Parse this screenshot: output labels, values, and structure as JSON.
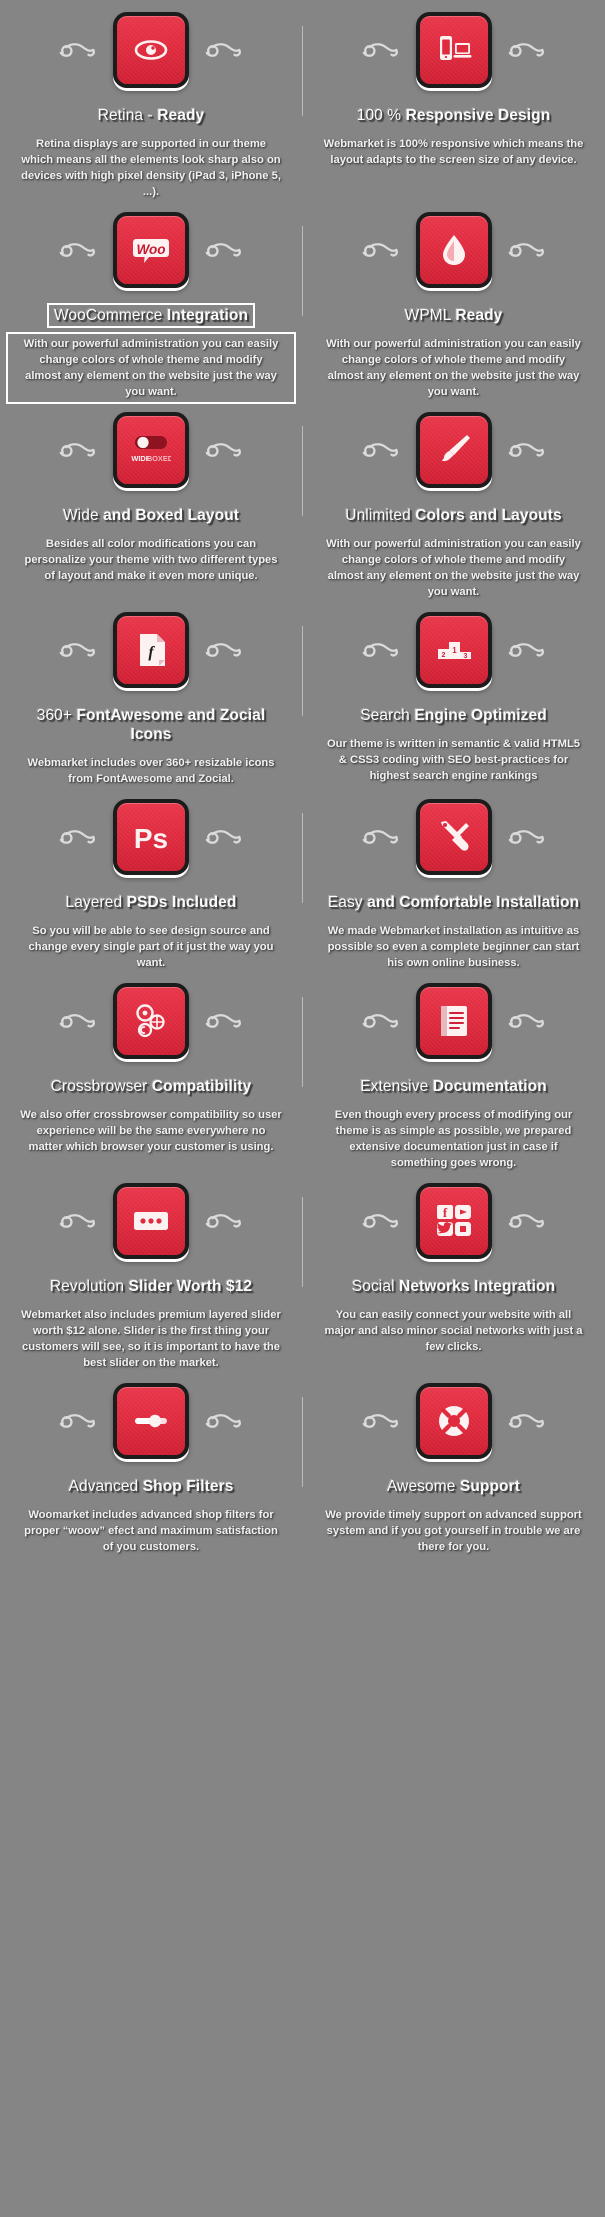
{
  "theme": {
    "background_color": "#858585",
    "accent_color": "#e02b3f",
    "icon_border_color": "#1c1c1c",
    "text_color": "#fbfbfb"
  },
  "features": [
    {
      "icon": "eye-icon",
      "title_light": "Retina - ",
      "title_bold": "Ready",
      "description": "Retina displays are supported in our theme which means all the elements look sharp also on devices with high pixel density (iPad 3, iPhone 5, ...).",
      "highlighted": false
    },
    {
      "icon": "responsive-devices-icon",
      "title_light": "100 % ",
      "title_bold": "Responsive Design",
      "description": "Webmarket is 100% responsive which means the layout adapts to the screen size of any device.",
      "highlighted": false
    },
    {
      "icon": "woocommerce-icon",
      "title_light": "WooCommerce ",
      "title_bold": "Integration",
      "description": "With our powerful administration you can easily change colors of whole theme and modify almost any element on the website just the way you want.",
      "highlighted": true
    },
    {
      "icon": "wpml-drop-icon",
      "title_light": "WPML ",
      "title_bold": "Ready",
      "description": "With our powerful administration you can easily change colors of whole theme and modify almost any element on the website just the way you want.",
      "highlighted": false
    },
    {
      "icon": "wide-boxed-toggle-icon",
      "title_light": "Wide ",
      "title_bold": "and Boxed Layout",
      "description": "Besides all color modifications you can personalize your theme with two different types of layout and make it even more unique.",
      "highlighted": false
    },
    {
      "icon": "paintbrush-icon",
      "title_light": "Unlimited ",
      "title_bold": "Colors and Layouts",
      "description": "With our powerful administration you can easily change colors of whole theme and modify almost any element on the website just the way you want.",
      "highlighted": false
    },
    {
      "icon": "font-file-icon",
      "title_light": "360+ ",
      "title_bold": "FontAwesome and Zocial Icons",
      "description": "Webmarket includes over 360+ resizable icons from FontAwesome and Zocial.",
      "highlighted": false
    },
    {
      "icon": "podium-ranking-icon",
      "title_light": "Search ",
      "title_bold": "Engine Optimized",
      "description": "Our theme is written in semantic & valid HTML5 & CSS3 coding with SEO best-practices for highest search engine rankings",
      "highlighted": false
    },
    {
      "icon": "photoshop-ps-icon",
      "title_light": "Layered ",
      "title_bold": "PSDs Included",
      "description": "So you will be able to see design source and change every single part of it just the way you want.",
      "highlighted": false
    },
    {
      "icon": "wrench-screwdriver-icon",
      "title_light": "Easy ",
      "title_bold": "and Comfortable Installation",
      "description": "We made Webmarket installation as intuitive as possible so even a complete beginner can start his own online business.",
      "highlighted": false
    },
    {
      "icon": "browsers-icon",
      "title_light": "Crossbrowser ",
      "title_bold": "Compatibility",
      "description": "We also offer crossbrowser compatibility so user experience will be the same everywhere no matter which browser your customer is using.",
      "highlighted": false
    },
    {
      "icon": "book-documentation-icon",
      "title_light": "Extensive ",
      "title_bold": "Documentation",
      "description": "Even though every process of modifying our theme is as simple as possible, we prepared extensive documentation just in case if something goes wrong.",
      "highlighted": false
    },
    {
      "icon": "slider-dots-icon",
      "title_light": "Revolution ",
      "title_bold": "Slider Worth $12",
      "description": "Webmarket also includes premium layered slider worth $12 alone. Slider is the first thing your customers will see, so it is important to have the best slider on the market.",
      "highlighted": false
    },
    {
      "icon": "social-networks-icon",
      "title_light": "Social ",
      "title_bold": "Networks Integration",
      "description": "You can easily connect your website with all major and also minor social networks with just a few clicks.",
      "highlighted": false
    },
    {
      "icon": "range-slider-icon",
      "title_light": "Advanced ",
      "title_bold": "Shop Filters",
      "description": "Woomarket includes advanced shop filters for proper “woow” efect and maximum satisfaction of you customers.",
      "highlighted": false
    },
    {
      "icon": "lifebuoy-support-icon",
      "title_light": "Awesome ",
      "title_bold": "Support",
      "description": "We provide timely support on advanced support system and if you got yourself in trouble we are there for you.",
      "highlighted": false
    }
  ]
}
